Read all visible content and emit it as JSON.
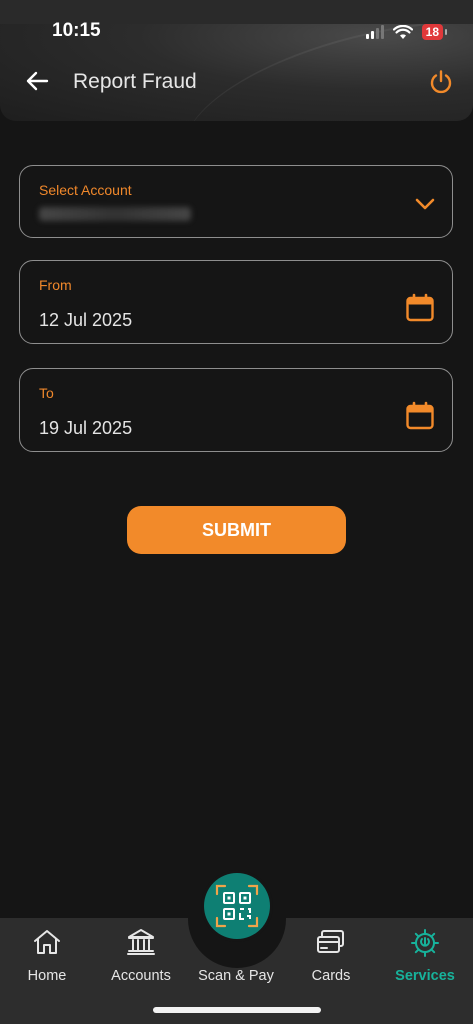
{
  "status_bar": {
    "time": "10:15",
    "battery": "18"
  },
  "header": {
    "title": "Report Fraud"
  },
  "form": {
    "account": {
      "label": "Select Account",
      "value": ""
    },
    "from": {
      "label": "From",
      "value": "12 Jul 2025"
    },
    "to": {
      "label": "To",
      "value": "19 Jul 2025"
    },
    "submit_label": "SUBMIT"
  },
  "nav": {
    "items": [
      {
        "label": "Home",
        "icon": "home-icon"
      },
      {
        "label": "Accounts",
        "icon": "bank-icon"
      },
      {
        "label": "Scan & Pay",
        "icon": "qr-code-icon"
      },
      {
        "label": "Cards",
        "icon": "cards-icon"
      },
      {
        "label": "Services",
        "icon": "settings-icon",
        "active": true
      }
    ]
  },
  "colors": {
    "accent": "#f28a2a",
    "active_nav": "#17b29b",
    "background": "#151515"
  }
}
